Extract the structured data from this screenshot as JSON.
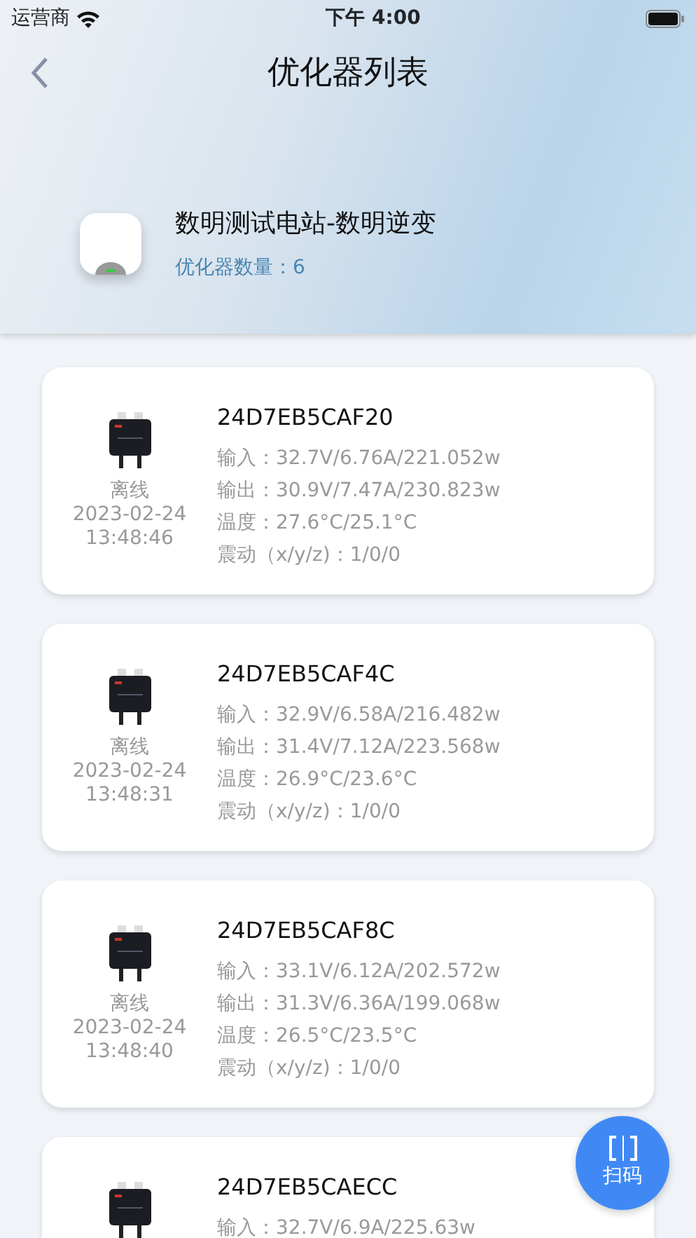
{
  "status_bar": {
    "carrier": "运营商",
    "time": "下午 4:00"
  },
  "nav": {
    "title": "优化器列表"
  },
  "station": {
    "name": "数明测试电站-数明逆变",
    "count": "优化器数量：6"
  },
  "optimizers": [
    {
      "serial": "24D7EB5CAF20",
      "status": "离线",
      "date": "2023-02-24",
      "time": "13:48:46",
      "lines": [
        "输入：32.7V/6.76A/221.052w",
        "输出：30.9V/7.47A/230.823w",
        "温度：27.6°C/25.1°C",
        "震动（x/y/z)：1/0/0"
      ]
    },
    {
      "serial": "24D7EB5CAF4C",
      "status": "离线",
      "date": "2023-02-24",
      "time": "13:48:31",
      "lines": [
        "输入：32.9V/6.58A/216.482w",
        "输出：31.4V/7.12A/223.568w",
        "温度：26.9°C/23.6°C",
        "震动（x/y/z)：1/0/0"
      ]
    },
    {
      "serial": "24D7EB5CAF8C",
      "status": "离线",
      "date": "2023-02-24",
      "time": "13:48:40",
      "lines": [
        "输入：33.1V/6.12A/202.572w",
        "输出：31.3V/6.36A/199.068w",
        "温度：26.5°C/23.5°C",
        "震动（x/y/z)：1/0/0"
      ]
    },
    {
      "serial": "24D7EB5CAECC",
      "lines": [
        "输入：32.7V/6.9A/225.63w"
      ]
    }
  ],
  "scan_button": {
    "label": "扫码"
  }
}
